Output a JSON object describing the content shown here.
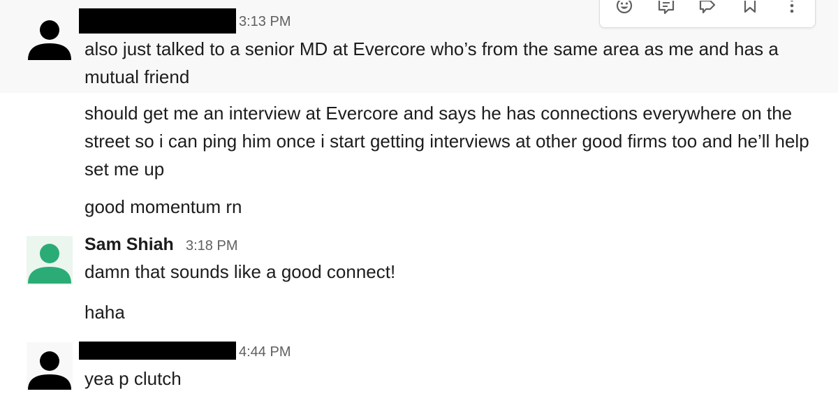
{
  "toolbar": {
    "icons": [
      "emoji-icon",
      "reply-thread-icon",
      "share-icon",
      "bookmark-icon",
      "more-actions-icon"
    ]
  },
  "messages": [
    {
      "sender": "",
      "sender_redacted": true,
      "avatar": "person-icon",
      "avatar_color": "#000000",
      "timestamp": "3:13 PM",
      "texts": [
        "also just talked to a senior MD at Evercore who’s from the same area as me and has a mutual friend",
        "should get me an interview at Evercore and says he has connections everywhere on the street so i can ping him once i start getting interviews at other good firms too and he’ll help set me up",
        "good momentum rn"
      ]
    },
    {
      "sender": "Sam Shiah",
      "sender_redacted": false,
      "avatar": "person-icon",
      "avatar_color": "#2bac76",
      "timestamp": "3:18 PM",
      "texts": [
        "damn that sounds like a good connect!",
        "haha"
      ]
    },
    {
      "sender": "",
      "sender_redacted": true,
      "avatar": "person-icon",
      "avatar_color": "#000000",
      "timestamp": "4:44 PM",
      "texts": [
        "yea p clutch"
      ]
    }
  ]
}
